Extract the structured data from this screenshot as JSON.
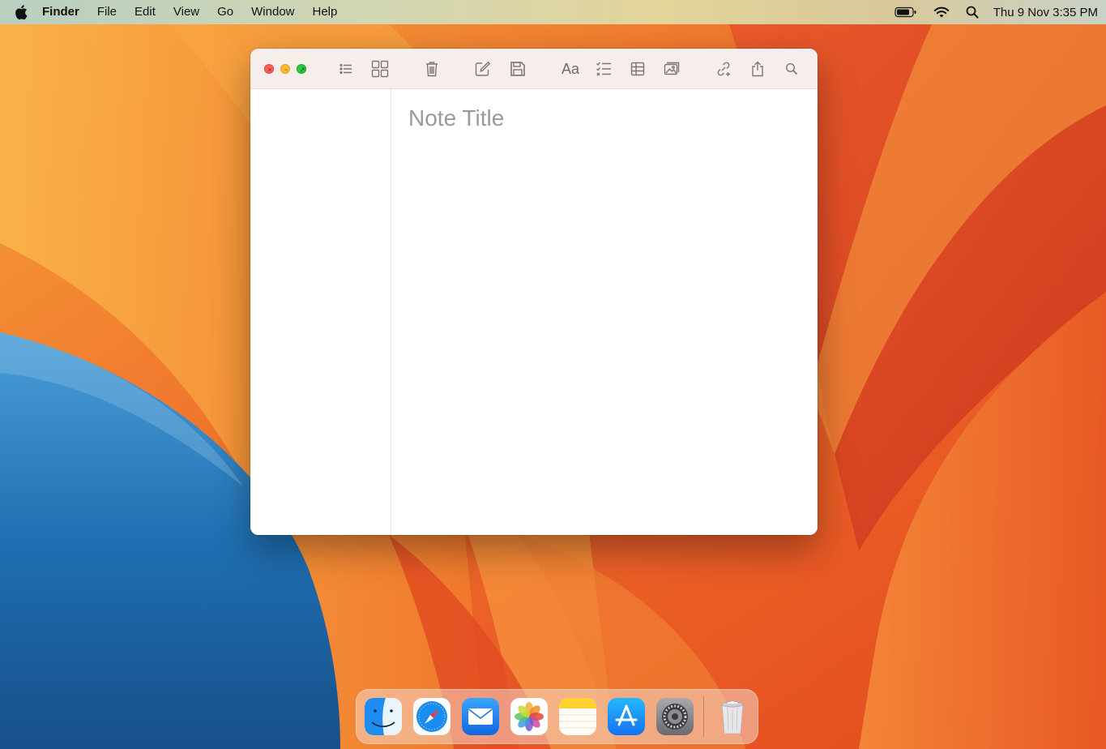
{
  "menubar": {
    "app_name": "Finder",
    "items": [
      "File",
      "Edit",
      "View",
      "Go",
      "Window",
      "Help"
    ],
    "clock": "Thu 9 Nov  3:35 PM",
    "status_icons": [
      "battery-icon",
      "wifi-icon",
      "spotlight-search-icon"
    ]
  },
  "window": {
    "app": "Notes",
    "toolbar_icons": [
      "list-view-icon",
      "gallery-view-icon",
      "trash-icon",
      "compose-icon",
      "save-icon",
      "format-text-icon",
      "checklist-icon",
      "table-icon",
      "media-icon",
      "link-icon",
      "share-icon",
      "search-icon"
    ],
    "format_label": "Aa",
    "note_title_placeholder": "Note Title"
  },
  "dock": {
    "apps": [
      "Finder",
      "Safari",
      "Mail",
      "Photos",
      "Notes",
      "App Store",
      "System Settings",
      "Trash"
    ]
  },
  "colors": {
    "wallpaper_orange": "#e8622a",
    "wallpaper_blue": "#1f6fb2",
    "close": "#fe5f57",
    "minimize": "#febc2e",
    "zoom": "#28c840"
  }
}
